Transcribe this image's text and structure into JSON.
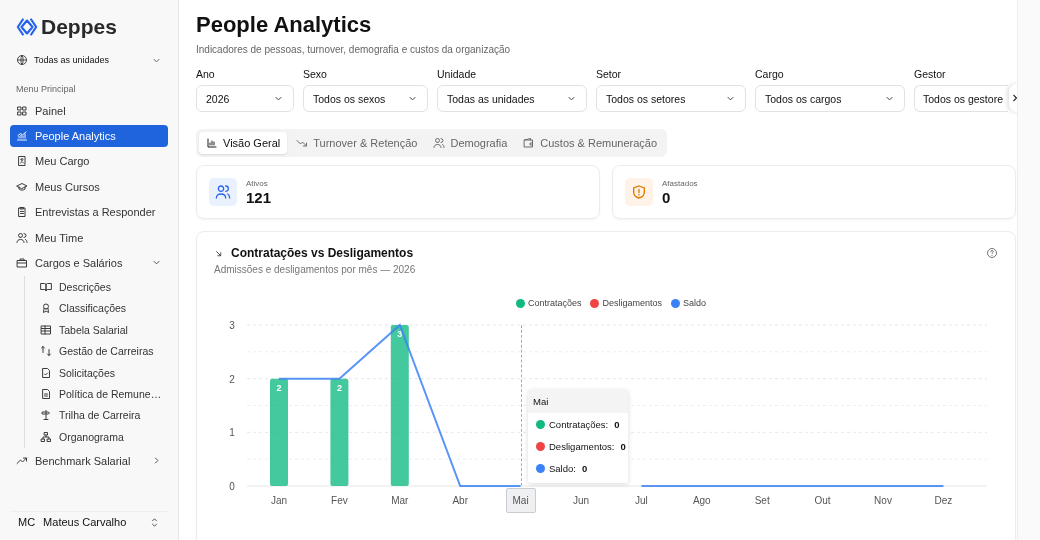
{
  "sidebar": {
    "logo": "Deppes",
    "unit_selector": "Todas as unidades",
    "section_label": "Menu Principal",
    "items": [
      {
        "label": "Painel",
        "selected": false
      },
      {
        "label": "People Analytics",
        "selected": true
      },
      {
        "label": "Meu Cargo",
        "selected": false
      },
      {
        "label": "Meus Cursos",
        "selected": false
      },
      {
        "label": "Entrevistas a Responder",
        "selected": false
      },
      {
        "label": "Meu Time",
        "selected": false
      },
      {
        "label": "Cargos e Salários",
        "selected": false,
        "expanded": true,
        "children": [
          {
            "label": "Descrições",
            "selected": false
          },
          {
            "label": "Classificações",
            "selected": false
          },
          {
            "label": "Tabela Salarial",
            "selected": false
          },
          {
            "label": "Gestão de Carreiras",
            "selected": false
          },
          {
            "label": "Solicitações",
            "selected": false
          },
          {
            "label": "Política de Remune…",
            "selected": false
          },
          {
            "label": "Trilha de Carreira",
            "selected": false
          },
          {
            "label": "Organograma",
            "selected": false
          }
        ]
      },
      {
        "label": "Benchmark Salarial",
        "selected": false,
        "expanded": false
      }
    ],
    "user": {
      "initials": "MC",
      "name": "Mateus Carvalho"
    }
  },
  "header": {
    "title": "People Analytics",
    "subtitle": "Indicadores de pessoas, turnover, demografia e custos da organização"
  },
  "filters": [
    {
      "label": "Ano",
      "value": "2026"
    },
    {
      "label": "Sexo",
      "value": "Todos os sexos"
    },
    {
      "label": "Unidade",
      "value": "Todas as unidades"
    },
    {
      "label": "Setor",
      "value": "Todos os setores"
    },
    {
      "label": "Cargo",
      "value": "Todos os cargos"
    },
    {
      "label": "Gestor",
      "value": "Todos os gestore"
    }
  ],
  "tabs": [
    {
      "label": "Visão Geral",
      "selected": true
    },
    {
      "label": "Turnover & Retenção",
      "selected": false
    },
    {
      "label": "Demografia",
      "selected": false
    },
    {
      "label": "Custos & Remuneração",
      "selected": false
    }
  ],
  "stats": [
    {
      "label": "Ativos",
      "value": "121",
      "kind": "users"
    },
    {
      "label": "Afastados",
      "value": "0",
      "kind": "alert"
    }
  ],
  "chart_card": {
    "title": "Contratações vs Desligamentos",
    "subtitle": "Admissões e desligamentos por mês — 2026",
    "chart_data": {
      "type": "bar",
      "categories": [
        "Jan",
        "Fev",
        "Mar",
        "Abr",
        "Mai",
        "Jun",
        "Jul",
        "Ago",
        "Set",
        "Out",
        "Nov",
        "Dez"
      ],
      "series": [
        {
          "name": "Contratações",
          "color": "#10b981",
          "values": [
            2,
            2,
            3,
            0,
            0,
            null,
            0,
            0,
            0,
            0,
            0,
            0
          ],
          "value_labels": [
            "2",
            "2",
            "3",
            null,
            null,
            null,
            null,
            null,
            null,
            null,
            null,
            null
          ]
        },
        {
          "name": "Desligamentos",
          "color": "#ef4444",
          "values": [
            0,
            0,
            0,
            0,
            0,
            null,
            0,
            0,
            0,
            0,
            0,
            0
          ]
        },
        {
          "name": "Saldo",
          "color": "#3b82f6",
          "type": "line",
          "values": [
            2,
            2,
            3,
            0,
            0,
            null,
            0,
            0,
            0,
            0,
            0,
            0
          ]
        }
      ],
      "ylim": [
        0,
        3
      ],
      "yticks": [
        0,
        1,
        2,
        3
      ]
    },
    "tooltip": {
      "title": "Mai",
      "rows": [
        {
          "label": "Contratações:",
          "value": "0",
          "color": "#10b981"
        },
        {
          "label": "Desligamentos:",
          "value": "0",
          "color": "#ef4444"
        },
        {
          "label": "Saldo:",
          "value": "0",
          "color": "#3b82f6"
        }
      ]
    }
  }
}
